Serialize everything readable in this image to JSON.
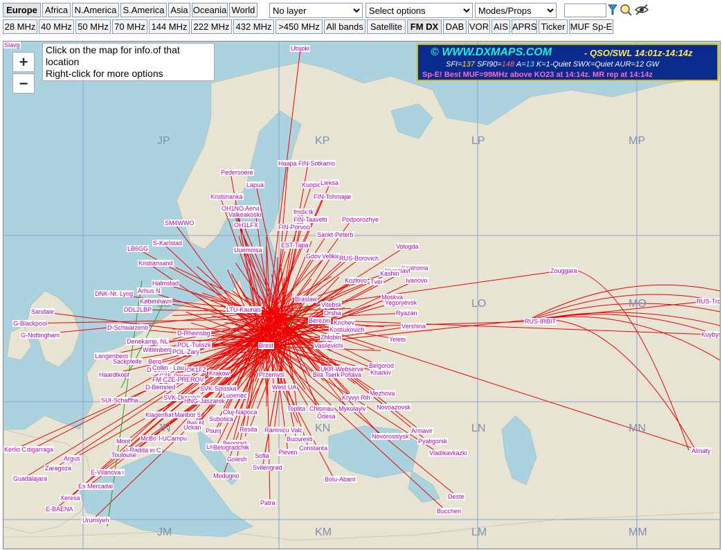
{
  "regions": [
    "Europe",
    "Africa",
    "N.America",
    "S.America",
    "Asia",
    "Oceania",
    "World"
  ],
  "layer_select": "No layer",
  "options_select": "Select options",
  "modes_select": "Modes/Props",
  "bands": [
    "28 MHz",
    "40 MHz",
    "50 MHz",
    "70 MHz",
    "144 MHz",
    "222 MHz",
    "432 MHz",
    ">450 MHz",
    "All bands",
    "Satellite",
    "FM DX",
    "DAB",
    "VOR",
    "AIS",
    "APRS",
    "Ticker",
    "MUF Sp-E"
  ],
  "zoom": {
    "in": "+",
    "out": "−"
  },
  "tip": {
    "line1": "Click on the map for info.of that location",
    "line2": "Right-click for more options"
  },
  "info": {
    "title": "© WWW.DXMAPS.COM",
    "time": "- QSO/SWL 14:01z-14:14z",
    "sfi_label": "SFI=",
    "sfi": "137",
    "sfi90_label": "SFI90=",
    "sfi90": "148",
    "a_label": "A=",
    "a": "13",
    "k": "K=1-Quiet",
    "swx": "SWX=Quiet",
    "aur": "AUR=12 GW",
    "alert": "Sp-E! Best MUF=99MHz above KO23 at 14:14z. MR rep at 14:14z"
  },
  "grid_labels": [
    "JP",
    "KP",
    "LP",
    "MP",
    "JO",
    "KO",
    "LO",
    "MO",
    "JN",
    "KN",
    "LN",
    "MN",
    "JM",
    "KM",
    "LM",
    "MM"
  ],
  "stations": [
    "Utsjoki",
    "Haapa",
    "FIN-Sotkamo",
    "Pedersoere",
    "Lapua",
    "Kuopio",
    "Lieksa",
    "Kristiinanka",
    "fmdx.tk",
    "FIN-Tohmajar",
    "OH1NOA",
    "Aervi",
    "Valkeakoski",
    "FIN-Taavetti",
    "Podporozhye",
    "SM4WWO",
    "OH1LFX",
    "FIN-Porvoo",
    "Sankt-Peterb",
    "S-Karlstad",
    "EST-Tapa",
    "Vologda",
    "LB6GG",
    "Uuemoisa",
    "Gdov",
    "Velikie",
    "RUS-Borovich",
    "Kristiansand",
    "Kostroma",
    "Yaroslavl",
    "Kashin",
    "Ivanovo",
    "Halmstad",
    "Kozlovo",
    "Tver",
    "DNK-Nr. Lyng",
    "Arhus N",
    "Moskva",
    "København",
    "Braslaw",
    "Yegoryevsk",
    "DDL2LBP",
    "LTU-Kaunas",
    "Vitebsk",
    "Ryazan",
    "Sandale",
    "Orsha",
    "Berezin",
    "Krichev",
    "Vershina",
    "G-Blackpool",
    "D-Schwarzenb",
    "Kostiukovich",
    "G-Nottingham",
    "D-Rheinsbg",
    "Zhlobin",
    "Yelets",
    "Denekamp, NL",
    "Brest",
    "Vasilevichi",
    "Wittenberg",
    "POL-Tuliszk",
    "Langenberg",
    "POL-Zary",
    "Sackpfeife",
    "Belgorod",
    "Berg",
    "D-Berlin",
    "UKR-Webserve",
    "Kharkiv",
    "Haardtkopf",
    "Collin - Lou",
    "OK1FZ",
    "Krakow",
    "Bila Tserkva",
    "Poltava",
    "CZE-Pilsen",
    "Przemysl",
    "FM CZE-PREROV",
    "D-Bernried",
    "West UA",
    "SVK-Spisska",
    "Mezhova",
    "SUI-Schaffha",
    "SVK-Dunajsk",
    "Luoenec",
    "Kryvyi Rih",
    "HNG-Jaszarok",
    "Toplita",
    "Novoazovsk",
    "Klagenfurt",
    "Maribor 5",
    "Cluj-Napoca",
    "Chisinau",
    "Mykolayiv",
    "Subotica",
    "Odesa",
    "Beli M",
    "Graz",
    "Uckan",
    "Resita",
    "Armavir",
    "Mont",
    "McBo",
    "I-UCampu",
    "Psunj",
    "Novorossiysk",
    "Pyatigorsk",
    "Astigarraga",
    "I-Radda in C",
    "Livorno",
    "Beograd",
    "Ramnicu Valc",
    "Bucuresti",
    "Toulouse",
    "Argus",
    "Belogradchik",
    "Kerlio C",
    "Sofia",
    "Pleven",
    "Constanta",
    "Vladikavkazki",
    "Zaragoza",
    "Golesh",
    "Svilengrad",
    "Almaty",
    "Guadalajara",
    "E-Vilanova i",
    "Modugno",
    "Bolu-Abant",
    "Es Mercadal",
    "Xeresa",
    "Patra",
    "Deste",
    "E-BAENA",
    "Buccheri",
    "Urumiyeh",
    "Zouggara",
    "RUS-IRBIT",
    "RUS-Troitsk",
    "Kuybys",
    "Slavg"
  ]
}
